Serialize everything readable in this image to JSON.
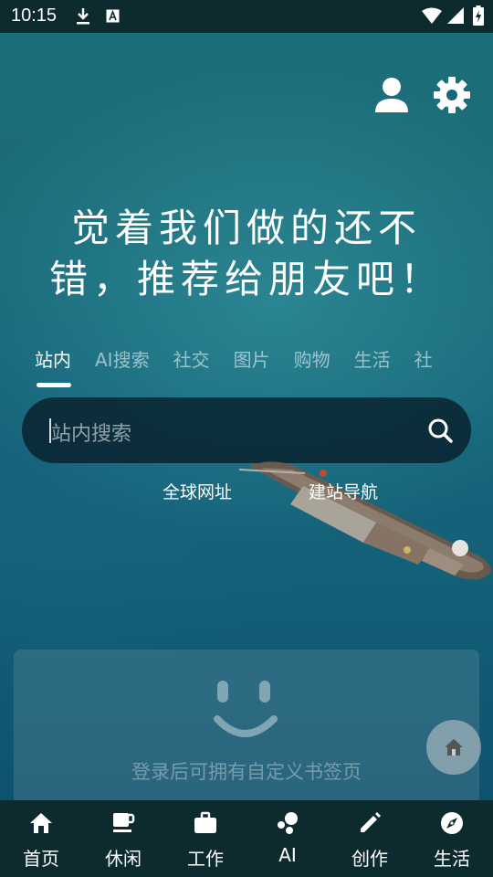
{
  "status_bar": {
    "time": "10:15",
    "icons": [
      "download-icon",
      "a-notification-icon",
      "wifi-icon",
      "signal-icon",
      "battery-charging-icon"
    ]
  },
  "header": {
    "icons": [
      "user-profile-icon",
      "settings-gear-icon"
    ]
  },
  "headline": {
    "line1": "觉着我们做的还不",
    "line2": "错，推荐给朋友吧！"
  },
  "tabs": [
    {
      "label": "站内",
      "active": true
    },
    {
      "label": "AI搜索",
      "active": false
    },
    {
      "label": "社交",
      "active": false
    },
    {
      "label": "图片",
      "active": false
    },
    {
      "label": "购物",
      "active": false
    },
    {
      "label": "生活",
      "active": false
    },
    {
      "label": "社",
      "active": false
    }
  ],
  "search": {
    "placeholder": "站内搜索",
    "icon": "search-icon"
  },
  "quick_links": [
    {
      "label": "全球网址"
    },
    {
      "label": "建站导航"
    }
  ],
  "bookmark_panel": {
    "icon": "smiley-face-icon",
    "message": "登录后可拥有自定义书签页"
  },
  "floating_button": {
    "icon": "home-icon"
  },
  "bottom_nav": [
    {
      "label": "首页",
      "icon": "home-icon"
    },
    {
      "label": "休闲",
      "icon": "coffee-cup-icon"
    },
    {
      "label": "工作",
      "icon": "briefcase-icon"
    },
    {
      "label": "AI",
      "icon": "ai-bubbles-icon"
    },
    {
      "label": "创作",
      "icon": "pencil-icon"
    },
    {
      "label": "生活",
      "icon": "compass-icon"
    }
  ],
  "colors": {
    "bar_background": "#0d2b2f",
    "accent_white": "#ffffff",
    "search_background": "#081c28"
  }
}
